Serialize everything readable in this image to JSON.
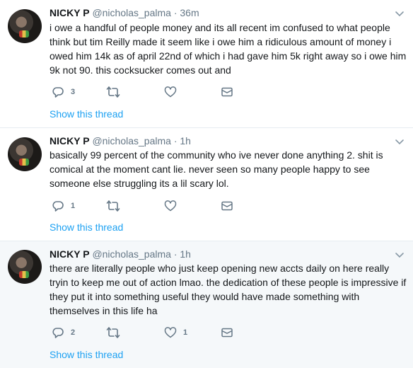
{
  "tweets": [
    {
      "name": "NICKY P",
      "handle": "@nicholas_palma",
      "dot": "·",
      "time": "36m",
      "text": "i owe a handful of people money and its all recent im confused to what people think but tim Reilly made it seem like i owe him a ridiculous amount of money i owed him 14k as of april 22nd of which i had gave him 5k right away so i owe him 9k not 90. this cocksucker comes out and",
      "replies": "3",
      "likes": "",
      "show_thread": "Show this thread"
    },
    {
      "name": "NICKY P",
      "handle": "@nicholas_palma",
      "dot": "·",
      "time": "1h",
      "text": "basically 99 percent of the community who ive never done anything 2. shit is comical at the moment cant lie. never seen so many people happy to see someone else struggling its a lil scary lol.",
      "replies": "1",
      "likes": "",
      "show_thread": "Show this thread"
    },
    {
      "name": "NICKY P",
      "handle": "@nicholas_palma",
      "dot": "·",
      "time": "1h",
      "text": "there are literally people who just keep opening new accts daily on here really tryin to keep me out of action lmao. the dedication of these people is impressive if they put it into something useful they would have made something with themselves in this life ha",
      "replies": "2",
      "likes": "1",
      "show_thread": "Show this thread"
    }
  ],
  "icons": {
    "reply": "reply-icon",
    "retweet": "retweet-icon",
    "like": "heart-icon",
    "dm": "envelope-icon",
    "more": "chevron-down-icon"
  },
  "colors": {
    "link": "#1da1f2",
    "secondary_text": "#657786",
    "highlight_bg": "#f5f8fa",
    "divider": "#e6ecf0"
  }
}
